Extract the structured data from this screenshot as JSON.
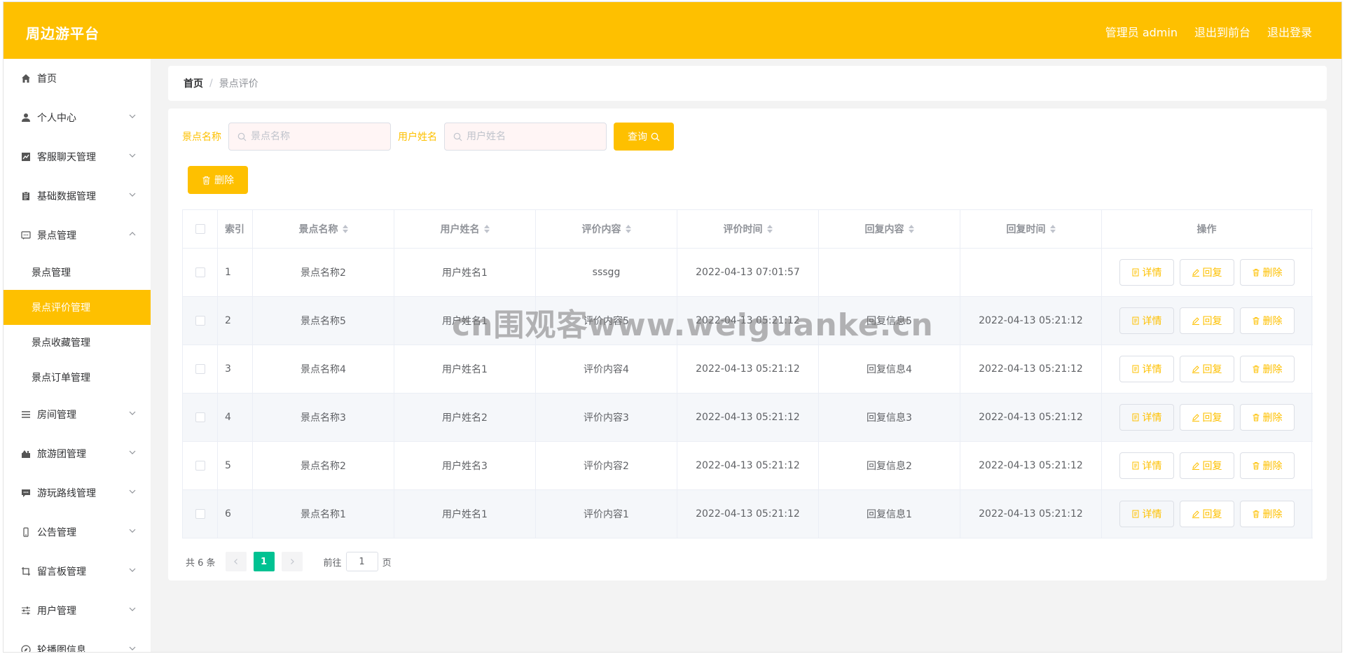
{
  "header": {
    "brand": "周边游平台",
    "admin_label": "管理员 admin",
    "front_link": "退出到前台",
    "logout_link": "退出登录"
  },
  "sidebar": {
    "items": [
      {
        "label": "首页",
        "icon": "home-icon"
      },
      {
        "label": "个人中心",
        "icon": "user-icon"
      },
      {
        "label": "客服聊天管理",
        "icon": "chart-icon"
      },
      {
        "label": "基础数据管理",
        "icon": "clipboard-icon"
      },
      {
        "label": "景点管理",
        "icon": "chat-icon",
        "expanded": true,
        "children": [
          "景点管理",
          "景点评价管理",
          "景点收藏管理",
          "景点订单管理"
        ],
        "active_child": "景点评价管理"
      },
      {
        "label": "房间管理",
        "icon": "list-icon"
      },
      {
        "label": "旅游团管理",
        "icon": "group-icon"
      },
      {
        "label": "游玩路线管理",
        "icon": "message-icon"
      },
      {
        "label": "公告管理",
        "icon": "phone-icon"
      },
      {
        "label": "留言板管理",
        "icon": "crop-icon"
      },
      {
        "label": "用户管理",
        "icon": "sliders-icon"
      },
      {
        "label": "轮播图信息",
        "icon": "compass-icon"
      }
    ]
  },
  "breadcrumb": {
    "home": "首页",
    "separator": "/",
    "current": "景点评价"
  },
  "search": {
    "scenic_label": "景点名称",
    "scenic_placeholder": "景点名称",
    "user_label": "用户姓名",
    "user_placeholder": "用户姓名",
    "query_button": "查询"
  },
  "toolbar": {
    "delete_button": "删除"
  },
  "table": {
    "headers": [
      "索引",
      "景点名称",
      "用户姓名",
      "评价内容",
      "评价时间",
      "回复内容",
      "回复时间",
      "操作"
    ],
    "rows": [
      {
        "index": "1",
        "scenic": "景点名称2",
        "user": "用户姓名1",
        "content": "sssgg",
        "time": "2022-04-13 07:01:57",
        "reply": "",
        "reply_time": ""
      },
      {
        "index": "2",
        "scenic": "景点名称5",
        "user": "用户姓名1",
        "content": "评价内容5",
        "time": "2022-04-13 05:21:12",
        "reply": "回复信息5",
        "reply_time": "2022-04-13 05:21:12"
      },
      {
        "index": "3",
        "scenic": "景点名称4",
        "user": "用户姓名1",
        "content": "评价内容4",
        "time": "2022-04-13 05:21:12",
        "reply": "回复信息4",
        "reply_time": "2022-04-13 05:21:12"
      },
      {
        "index": "4",
        "scenic": "景点名称3",
        "user": "用户姓名2",
        "content": "评价内容3",
        "time": "2022-04-13 05:21:12",
        "reply": "回复信息3",
        "reply_time": "2022-04-13 05:21:12"
      },
      {
        "index": "5",
        "scenic": "景点名称2",
        "user": "用户姓名3",
        "content": "评价内容2",
        "time": "2022-04-13 05:21:12",
        "reply": "回复信息2",
        "reply_time": "2022-04-13 05:21:12"
      },
      {
        "index": "6",
        "scenic": "景点名称1",
        "user": "用户姓名1",
        "content": "评价内容1",
        "time": "2022-04-13 05:21:12",
        "reply": "回复信息1",
        "reply_time": "2022-04-13 05:21:12"
      }
    ],
    "actions": {
      "detail": "详情",
      "reply": "回复",
      "delete": "删除"
    }
  },
  "pagination": {
    "total": "共 6 条",
    "current_page": "1",
    "goto_prefix": "前往",
    "goto_value": "1",
    "goto_suffix": "页"
  },
  "watermark": "cn围观客www.weiguanke.cn",
  "colors": {
    "accent": "#fec000",
    "pager_active": "#00c292"
  }
}
